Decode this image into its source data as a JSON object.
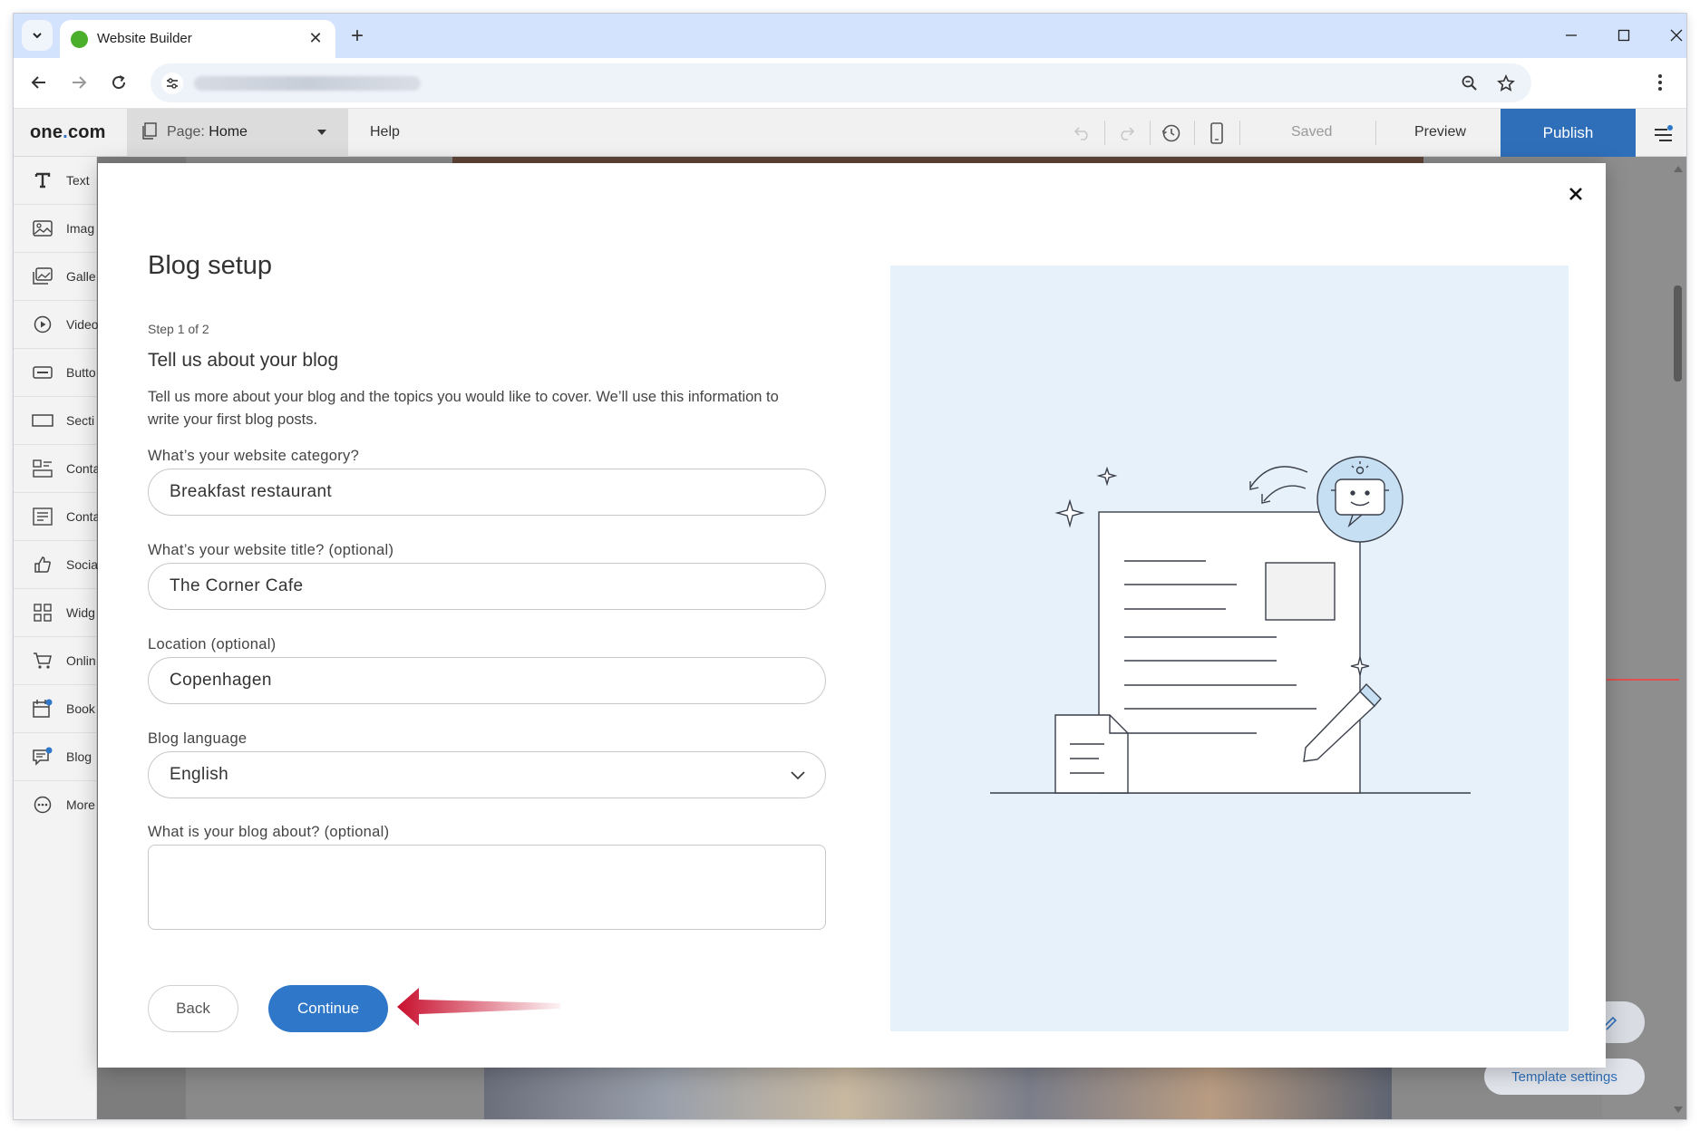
{
  "browser": {
    "tab_title": "Website Builder",
    "new_tab_symbol": "+",
    "close_symbol": "✕"
  },
  "header": {
    "logo_main": "one",
    "logo_dot": ".",
    "logo_tld": "com",
    "page_prefix": "Page:",
    "page_name": "Home",
    "help": "Help",
    "saved": "Saved",
    "preview": "Preview",
    "publish": "Publish"
  },
  "sidebar": {
    "items": [
      {
        "label": "Text",
        "icon": "text-icon"
      },
      {
        "label": "Imag",
        "icon": "image-icon"
      },
      {
        "label": "Galle",
        "icon": "gallery-icon"
      },
      {
        "label": "Video",
        "icon": "video-icon"
      },
      {
        "label": "Butto",
        "icon": "button-icon"
      },
      {
        "label": "Secti",
        "icon": "section-icon"
      },
      {
        "label": "Conta",
        "icon": "contact-icon"
      },
      {
        "label": "Conta",
        "icon": "contact-form-icon"
      },
      {
        "label": "Socia",
        "icon": "social-icon"
      },
      {
        "label": "Widg",
        "icon": "widget-icon"
      },
      {
        "label": "Onlin",
        "icon": "cart-icon"
      },
      {
        "label": "Book",
        "icon": "booking-icon"
      },
      {
        "label": "Blog",
        "icon": "blog-icon"
      },
      {
        "label": "More",
        "icon": "more-icon"
      }
    ]
  },
  "canvas": {
    "template_settings": "Template settings"
  },
  "modal": {
    "title": "Blog setup",
    "step": "Step 1 of 2",
    "subtitle": "Tell us about your blog",
    "description": "Tell us more about your blog and the topics you would like to cover. We’ll use this information to write your first blog posts.",
    "fields": {
      "category": {
        "label": "What’s your website category?",
        "value": "Breakfast restaurant"
      },
      "title": {
        "label": "What’s your website title? (optional)",
        "value": "The Corner Cafe"
      },
      "location": {
        "label": "Location (optional)",
        "value": "Copenhagen"
      },
      "language": {
        "label": "Blog language",
        "value": "English"
      },
      "about": {
        "label": "What is your blog about? (optional)",
        "value": ""
      }
    },
    "back": "Back",
    "continue": "Continue"
  },
  "colors": {
    "accent": "#2f77c8",
    "publish_bg": "#2f6fba",
    "illustration_bg": "#e7f1fa",
    "arrow": "#c8102e"
  }
}
